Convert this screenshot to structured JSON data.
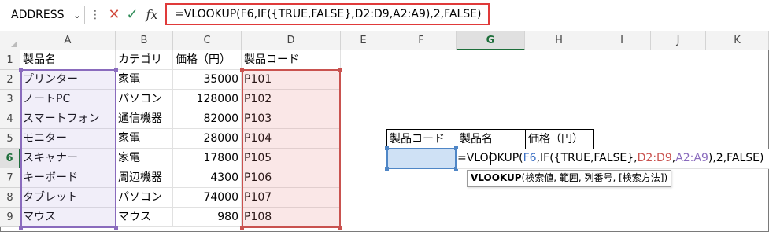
{
  "formula_bar": {
    "name_box": "ADDRESS",
    "cancel_icon": "close-icon",
    "enter_icon": "check-icon",
    "fx_label": "fx",
    "formula": "=VLOOKUP(F6,IF({TRUE,FALSE},D2:D9,A2:A9),2,FALSE)"
  },
  "columns": [
    "A",
    "B",
    "C",
    "D",
    "E",
    "F",
    "G",
    "H",
    "I",
    "J",
    "K"
  ],
  "rows": [
    "1",
    "2",
    "3",
    "4",
    "5",
    "6",
    "7",
    "8",
    "9"
  ],
  "table": {
    "headers": [
      "製品名",
      "カテゴリ",
      "価格（円）",
      "製品コード"
    ],
    "rows": [
      [
        "プリンター",
        "家電",
        "35000",
        "P101"
      ],
      [
        "ノートPC",
        "パソコン",
        "128000",
        "P102"
      ],
      [
        "スマートフォン",
        "通信機器",
        "82000",
        "P103"
      ],
      [
        "モニター",
        "家電",
        "28000",
        "P104"
      ],
      [
        "スキャナー",
        "家電",
        "17800",
        "P105"
      ],
      [
        "キーボード",
        "周辺機器",
        "4300",
        "P106"
      ],
      [
        "タブレット",
        "パソコン",
        "74000",
        "P107"
      ],
      [
        "マウス",
        "マウス",
        "980",
        "P108"
      ]
    ]
  },
  "lookup": {
    "headers": [
      "製品コード",
      "製品名",
      "価格（円）"
    ]
  },
  "edit": {
    "prefix": "=VLOOKUP(",
    "arg1": "F6",
    "mid1": ",IF({TRUE,FALSE},",
    "arg2": "D2:D9",
    "comma": ",",
    "arg3": "A2:A9",
    "suffix": "),2,FALSE)"
  },
  "tooltip": {
    "func": "VLOOKUP",
    "args": "(検索値, 範囲, 列番号, [検索方法])"
  },
  "colors": {
    "formula_border": "#e03a3a",
    "range_d": "#c9524f",
    "range_a": "#8a6bbd",
    "ref_f6": "#4f86c6",
    "active_header": "#1d6e3a"
  }
}
